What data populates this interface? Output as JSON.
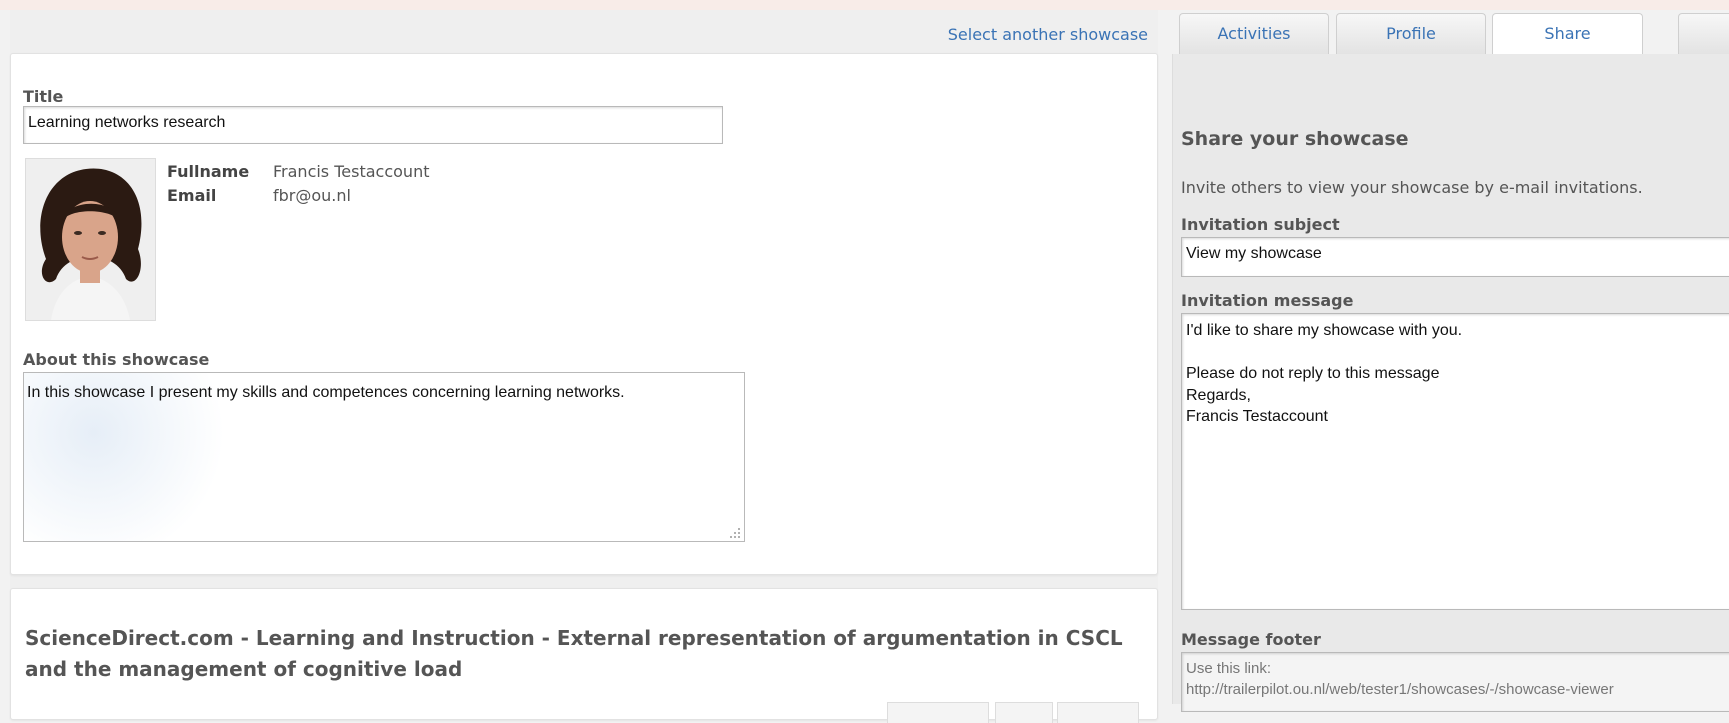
{
  "showcase": {
    "select_link": "Select another showcase",
    "title_label": "Title",
    "title_value": "Learning networks research",
    "fullname_label": "Fullname",
    "fullname_value": "Francis Testaccount",
    "email_label": "Email",
    "email_value": "fbr@ou.nl",
    "about_label": "About this showcase",
    "about_value": "In this showcase I present my skills and competences concerning learning networks."
  },
  "article": {
    "title": "ScienceDirect.com - Learning and Instruction - External representation of argumentation in CSCL and the management of cognitive load"
  },
  "tabs": [
    {
      "label": "Activities"
    },
    {
      "label": "Profile"
    },
    {
      "label": "Share"
    }
  ],
  "share": {
    "heading": "Share your showcase",
    "description": "Invite others to view your showcase by e-mail invitations.",
    "subject_label": "Invitation subject",
    "subject_value": "View my showcase",
    "message_label": "Invitation message",
    "message_lines": [
      "I'd like to share my showcase with you.",
      "",
      "Please do not reply to this message",
      "Regards,",
      "Francis Testaccount"
    ],
    "footer_label": "Message footer",
    "footer_line1": "Use this link:",
    "footer_line2": "http://trailerpilot.ou.nl/web/tester1/showcases/-/showcase-viewer"
  },
  "colors": {
    "link": "#3a73b5",
    "panel_bg": "#ffffff",
    "page_bg": "#efefef"
  }
}
